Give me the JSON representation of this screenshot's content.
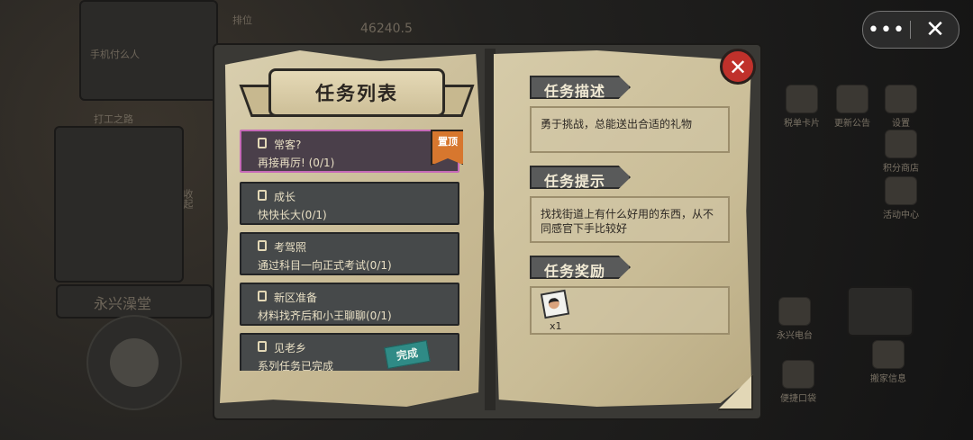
{
  "background": {
    "coins_value": "46240.5",
    "rank_label": "排位",
    "pay_button": "手机付么人",
    "shop_sign": "永兴澡堂",
    "left_items": [
      "打工之路",
      "收起"
    ],
    "right_items": [
      "税单卡片",
      "更新公告",
      "设置",
      "积分商店",
      "活动中心",
      "永兴电台",
      "搬家信息",
      "便捷口袋"
    ]
  },
  "capsule": {
    "more_icon": "more-dots-icon",
    "more_label": "•••",
    "exit_icon": "close-icon",
    "exit_label": "✕"
  },
  "dialog": {
    "title": "任务列表",
    "close_label": "✕",
    "tasks": [
      {
        "name": "常客?",
        "desc": "再接再厉! (0/1)",
        "selected": true,
        "pinned": true,
        "pin_label": "置顶"
      },
      {
        "name": "成长",
        "desc": "快快长大(0/1)",
        "selected": false
      },
      {
        "name": "考驾照",
        "desc": "通过科目一向正式考试(0/1)",
        "selected": false
      },
      {
        "name": "新区准备",
        "desc": "材料找齐后和小王聊聊(0/1)",
        "selected": false
      },
      {
        "name": "见老乡",
        "desc": "系列任务已完成",
        "selected": false,
        "done": true,
        "done_label": "完成"
      }
    ],
    "description_header": "任务描述",
    "description_text": "勇于挑战，总能送出合适的礼物",
    "hint_header": "任务提示",
    "hint_text": "找找街道上有什么好用的东西，从不同感官下手比较好",
    "reward_header": "任务奖励",
    "reward_icon": "photo-card-icon",
    "reward_qty": "x1"
  }
}
